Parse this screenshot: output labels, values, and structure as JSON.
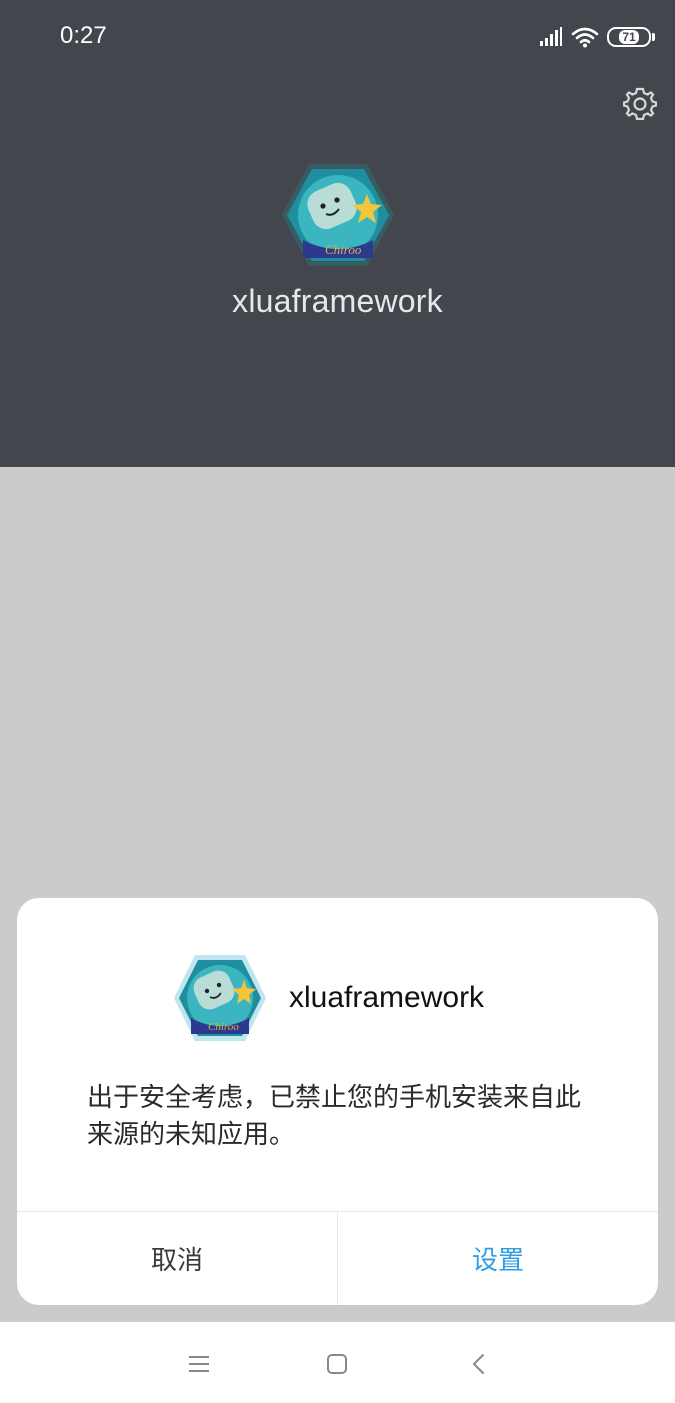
{
  "status_bar": {
    "time": "0:27",
    "battery": "71",
    "icons": [
      "signal-icon",
      "wifi-icon",
      "battery-icon"
    ]
  },
  "header": {
    "app_name": "xluaframework",
    "settings_icon": "gear-icon"
  },
  "dialog": {
    "app_name": "xluaframework",
    "message": "出于安全考虑，已禁止您的手机安装来自此来源的未知应用。",
    "buttons": {
      "cancel": "取消",
      "settings": "设置"
    }
  },
  "nav": {
    "icons": [
      "menu-icon",
      "home-icon",
      "back-icon"
    ]
  },
  "colors": {
    "header_bg": "#43464d",
    "scrim_bg": "#cbcbcb",
    "accent_blue": "#2f9ee6"
  }
}
